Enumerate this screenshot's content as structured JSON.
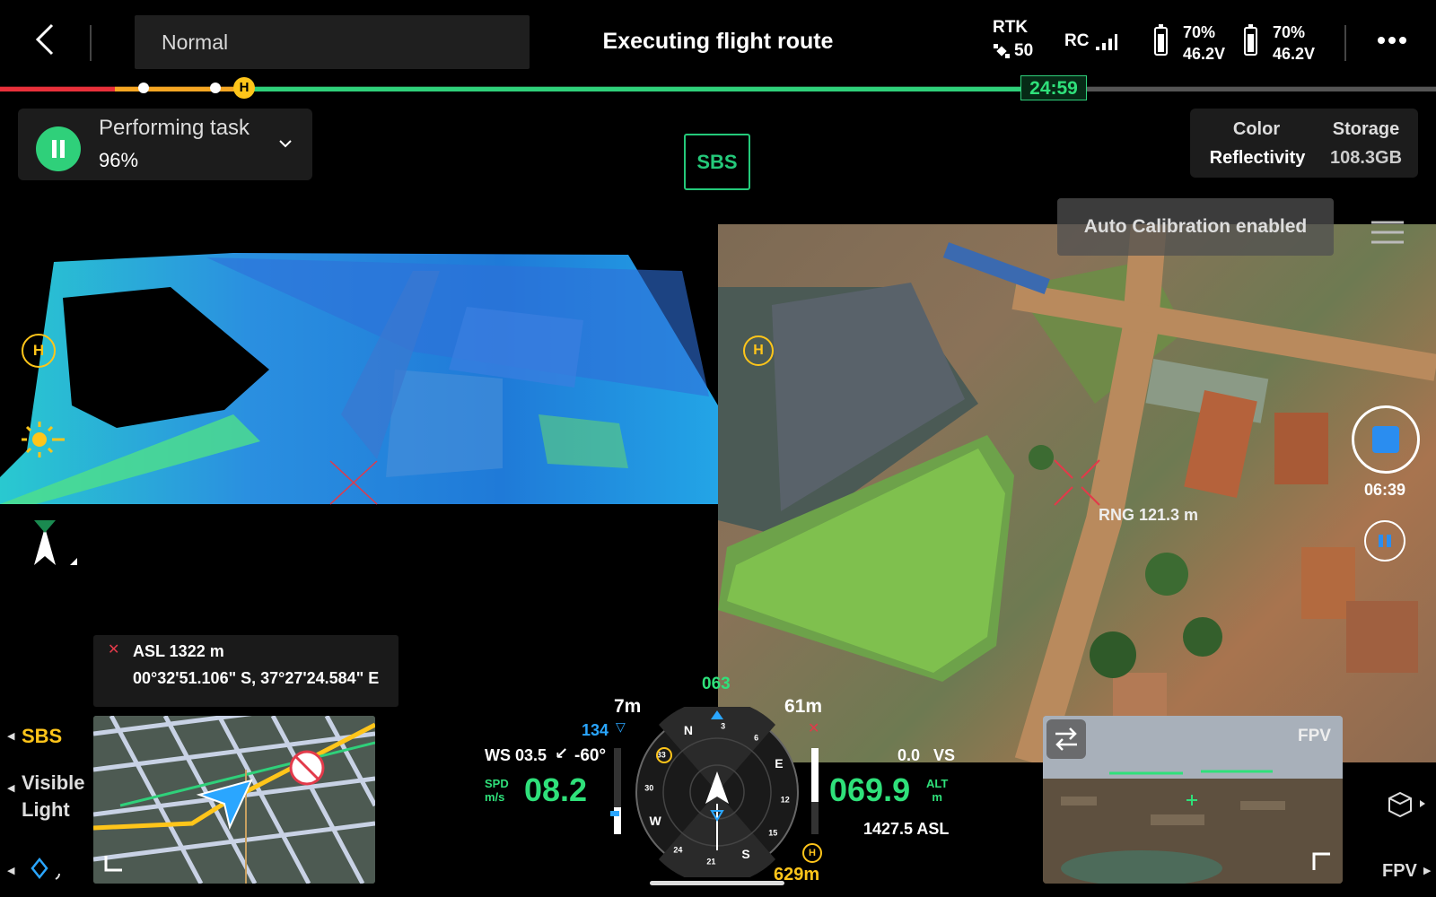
{
  "top_bar": {
    "flight_mode": "Normal",
    "title": "Executing flight route",
    "rtk_label": "RTK",
    "rtk_count": "50",
    "rc_label": "RC",
    "battery1_pct": "70%",
    "battery1_volt": "46.2V",
    "battery1_level": 0.7,
    "battery2_pct": "70%",
    "battery2_volt": "46.2V",
    "battery2_level": 0.7
  },
  "route_progress": {
    "remaining_time": "24:59",
    "home_marker": "H"
  },
  "task": {
    "status": "Performing task",
    "percent": "96%"
  },
  "view_mode_button": "SBS",
  "camera_info": {
    "color_label": "Color",
    "color_value": "Reflectivity",
    "storage_label": "Storage",
    "storage_value": "108.3GB"
  },
  "notice": "Auto Calibration enabled",
  "video": {
    "range": "RNG 121.3 m",
    "record_time": "06:39",
    "home_marker": "H"
  },
  "target": {
    "asl": "ASL 1322 m",
    "coordinates": "00°32'51.106\" S, 37°27'24.584\" E"
  },
  "left_controls": {
    "sbs": "SBS",
    "visible_line1": "Visible",
    "visible_line2": "Light"
  },
  "flight_data": {
    "heading": "063",
    "height_left": "7m",
    "height_right": "61m",
    "waypoint_dist": "134",
    "wind": "WS 03.5",
    "wind_angle": "-60°",
    "speed_unit1": "SPD",
    "speed_unit2": "m/s",
    "speed": "08.2",
    "vs": "0.0",
    "vs_label": "VS",
    "altitude": "069.9",
    "alt_label": "ALT",
    "alt_unit": "m",
    "asl": "1427.5 ASL",
    "home_dist": "629m",
    "compass": [
      "N",
      "3",
      "6",
      "E",
      "12",
      "15",
      "S",
      "21",
      "24",
      "W",
      "30",
      "33"
    ]
  },
  "fpv": {
    "label": "FPV",
    "switch_label": "FPV"
  }
}
